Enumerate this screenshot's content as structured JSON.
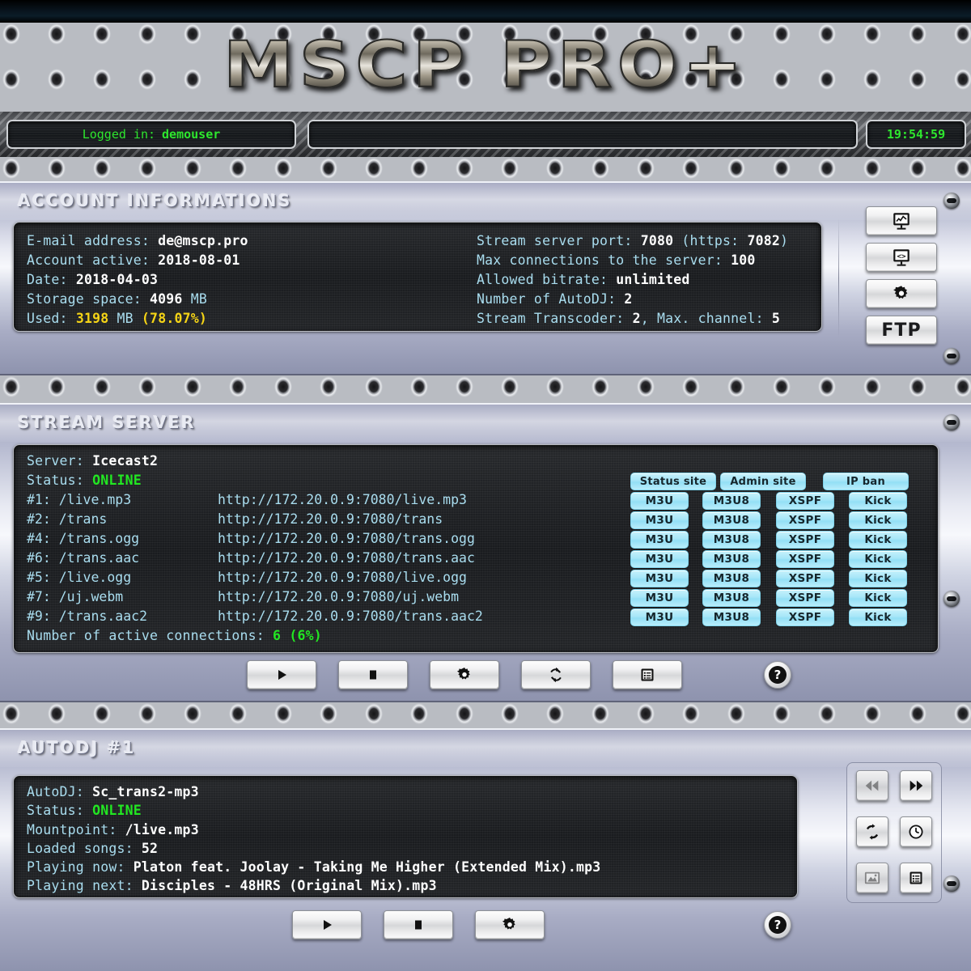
{
  "brand": {
    "logo": "MSCP PRO+"
  },
  "statusbar": {
    "login_label": "Logged in:",
    "login_user": "demouser",
    "ticker": "",
    "clock": "19:54:59"
  },
  "account": {
    "title": "ACCOUNT INFORMATIONS",
    "left": [
      {
        "label": "E-mail address:",
        "value": "de@mscp.pro",
        "style": "white"
      },
      {
        "label": "Account active:",
        "value": "2018-08-01",
        "style": "white"
      },
      {
        "label": "Date:",
        "value": "2018-04-03",
        "style": "white"
      },
      {
        "label": "Storage space:",
        "value": "4096",
        "suffix": "MB",
        "style": "white"
      },
      {
        "label": "Used:",
        "value": "3198",
        "suffix": "MB",
        "extra": "(78.07%)",
        "style": "yellow"
      }
    ],
    "right": [
      {
        "label": "Stream server port:",
        "value": "7080",
        "tail_label": "(https:",
        "tail_value": "7082",
        "tail_end": ")"
      },
      {
        "label": "Max connections to the server:",
        "value": "100"
      },
      {
        "label": "Allowed bitrate:",
        "value": "unlimited"
      },
      {
        "label": "Number of AutoDJ:",
        "value": "2"
      },
      {
        "label": "Stream Transcoder:",
        "value": "2",
        "tail_label": ", Max. channel:",
        "tail_value": "5"
      }
    ],
    "buttons": [
      {
        "name": "statistics-button",
        "icon": "chart-monitor-icon",
        "label": ""
      },
      {
        "name": "embed-code-button",
        "icon": "code-monitor-icon",
        "label": ""
      },
      {
        "name": "account-settings-button",
        "icon": "gear-icon",
        "label": ""
      },
      {
        "name": "ftp-button",
        "icon": "",
        "label": "FTP"
      }
    ]
  },
  "stream_server": {
    "title": "STREAM SERVER",
    "server_label": "Server:",
    "server_value": "Icecast2",
    "status_label": "Status:",
    "status_value": "ONLINE",
    "mounts": [
      {
        "id": "#1:",
        "path": "/live.mp3",
        "url": "http://172.20.0.9:7080/live.mp3"
      },
      {
        "id": "#2:",
        "path": "/trans",
        "url": "http://172.20.0.9:7080/trans"
      },
      {
        "id": "#4:",
        "path": "/trans.ogg",
        "url": "http://172.20.0.9:7080/trans.ogg"
      },
      {
        "id": "#6:",
        "path": "/trans.aac",
        "url": "http://172.20.0.9:7080/trans.aac"
      },
      {
        "id": "#5:",
        "path": "/live.ogg",
        "url": "http://172.20.0.9:7080/live.ogg"
      },
      {
        "id": "#7:",
        "path": "/uj.webm",
        "url": "http://172.20.0.9:7080/uj.webm"
      },
      {
        "id": "#9:",
        "path": "/trans.aac2",
        "url": "http://172.20.0.9:7080/trans.aac2"
      }
    ],
    "connections_label": "Number of active connections:",
    "connections_value": "6",
    "connections_pct": "(6%)",
    "top_buttons": [
      {
        "name": "status-site-button",
        "label": "Status site"
      },
      {
        "name": "admin-site-button",
        "label": "Admin site"
      },
      {
        "name": "ip-ban-button",
        "label": "IP ban"
      }
    ],
    "row_buttons": [
      "M3U",
      "M3U8",
      "XSPF",
      "Kick"
    ],
    "controls": [
      {
        "name": "stream-start-button",
        "icon": "play-icon"
      },
      {
        "name": "stream-stop-button",
        "icon": "stop-icon"
      },
      {
        "name": "stream-settings-button",
        "icon": "gear-icon"
      },
      {
        "name": "stream-restart-button",
        "icon": "refresh-icon"
      },
      {
        "name": "stream-log-button",
        "icon": "list-icon"
      }
    ],
    "help_label": "?"
  },
  "autodj": {
    "title": "AUTODJ #1",
    "lines": [
      {
        "label": "AutoDJ:",
        "value": "Sc_trans2-mp3",
        "style": "white"
      },
      {
        "label": "Status:",
        "value": "ONLINE",
        "style": "online"
      },
      {
        "label": "Mountpoint:",
        "value": "/live.mp3",
        "style": "white"
      },
      {
        "label": "Loaded songs:",
        "value": "52",
        "style": "white"
      },
      {
        "label": "Playing now:",
        "value": "Platon feat. Joolay - Taking Me Higher (Extended Mix).mp3",
        "style": "white"
      },
      {
        "label": "Playing next:",
        "value": "Disciples - 48HRS (Original Mix).mp3",
        "style": "white"
      }
    ],
    "side_buttons": [
      {
        "name": "autodj-prev-button",
        "icon": "prev-double-icon",
        "disabled": true
      },
      {
        "name": "autodj-next-button",
        "icon": "next-double-icon",
        "disabled": false
      },
      {
        "name": "autodj-reload-button",
        "icon": "refresh-icon",
        "disabled": false
      },
      {
        "name": "autodj-schedule-button",
        "icon": "clock-icon",
        "disabled": false
      },
      {
        "name": "autodj-cover-button",
        "icon": "image-icon",
        "disabled": true
      },
      {
        "name": "autodj-playlist-button",
        "icon": "list-icon",
        "disabled": false
      }
    ],
    "controls": [
      {
        "name": "autodj-start-button",
        "icon": "play-icon"
      },
      {
        "name": "autodj-stop-button",
        "icon": "stop-icon"
      },
      {
        "name": "autodj-settings-button",
        "icon": "gear-icon"
      }
    ],
    "help_label": "?"
  },
  "colors": {
    "lcd_green": "#22e722",
    "console_cyan": "#a9ddef",
    "value_white": "#ffffff",
    "warn_yellow": "#f5d416",
    "cyan_button": "#a6e6f8"
  }
}
